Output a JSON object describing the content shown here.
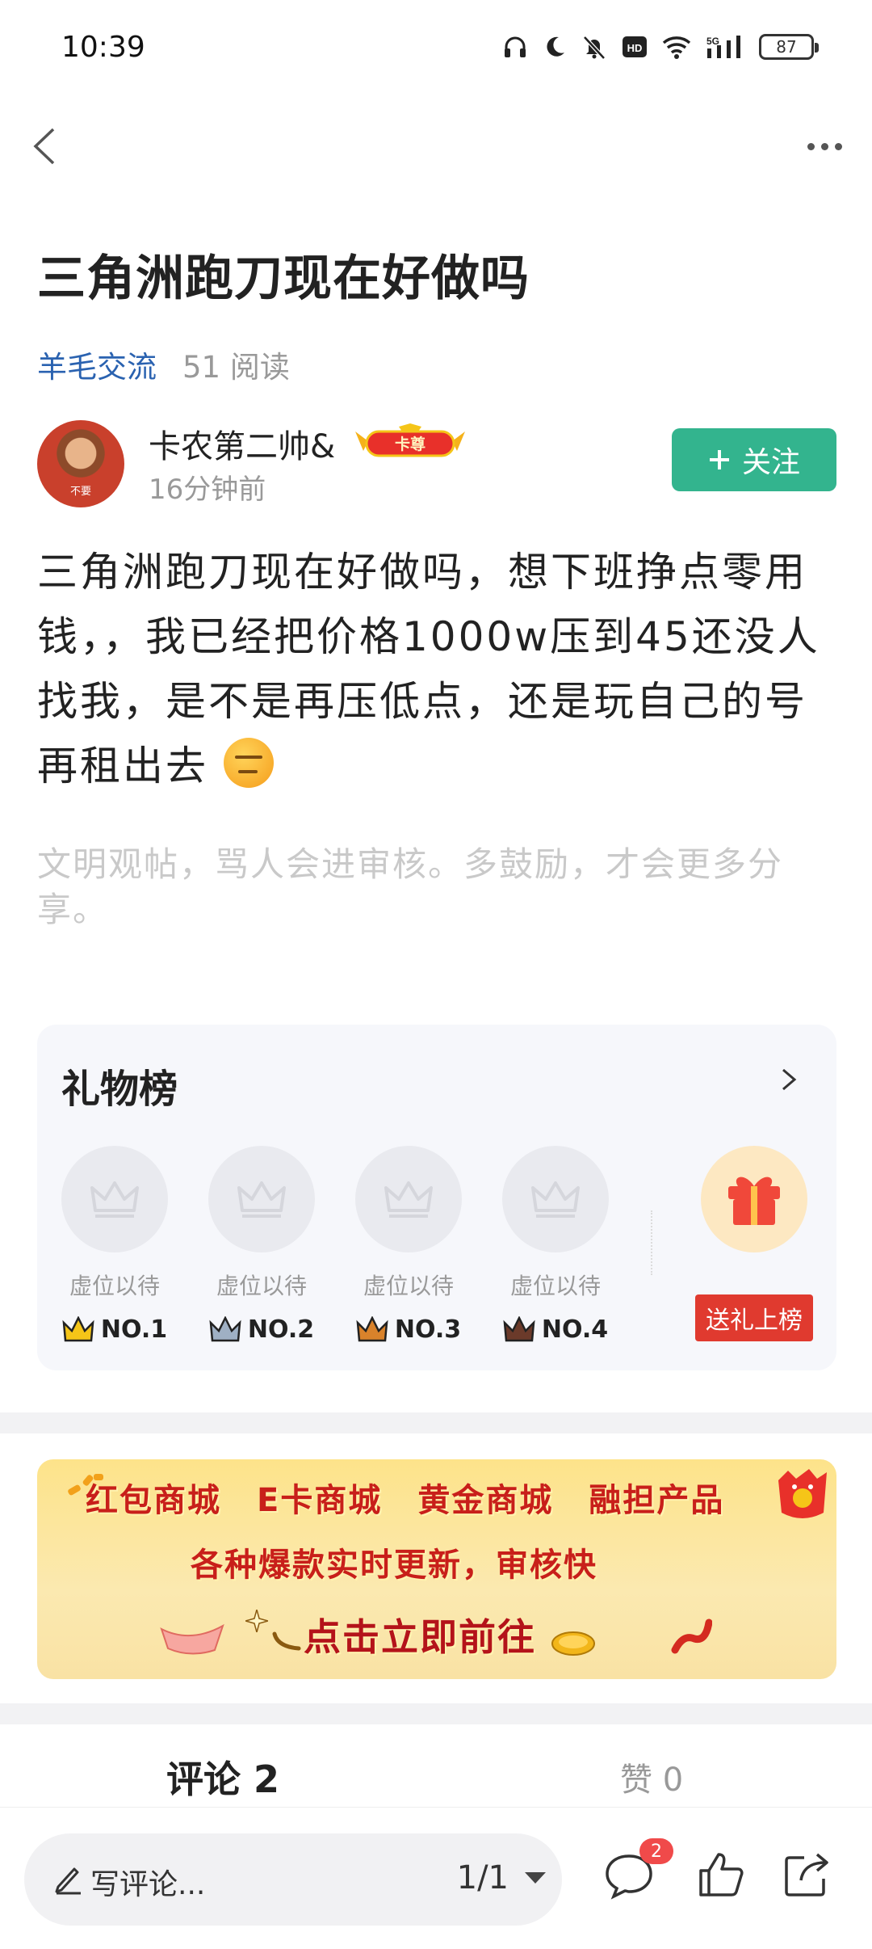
{
  "status_bar": {
    "time": "10:39",
    "battery": "87",
    "icons": [
      "headphones-icon",
      "moon-icon",
      "mute-icon",
      "hd-icon",
      "wifi-icon",
      "5g-signal-icon",
      "battery-icon"
    ]
  },
  "nav": {
    "back_icon": "chevron-left-icon",
    "more_icon": "more-dots-icon"
  },
  "post": {
    "title": "三角洲跑刀现在好做吗",
    "category": "羊毛交流",
    "reads": "51 阅读",
    "author": {
      "name": "卡农第二帅&",
      "badge": "卡尊",
      "time": "16分钟前",
      "avatar_text": "不要"
    },
    "follow_label": "关注",
    "content": "三角洲跑刀现在好做吗，想下班挣点零用钱，，我已经把价格1000w压到45还没人找我，是不是再压低点，还是玩自己的号再租出去",
    "notice": "文明观帖，骂人会进审核。多鼓励，才会更多分享。"
  },
  "gift_board": {
    "title": "礼物榜",
    "slots": [
      {
        "label": "虚位以待",
        "rank": "NO.1",
        "crown_color": "#f5c518"
      },
      {
        "label": "虚位以待",
        "rank": "NO.2",
        "crown_color": "#9fb0c4"
      },
      {
        "label": "虚位以待",
        "rank": "NO.3",
        "crown_color": "#d9822b"
      },
      {
        "label": "虚位以待",
        "rank": "NO.4",
        "crown_color": "#6b3a2a"
      }
    ],
    "send_label": "送礼上榜"
  },
  "banner": {
    "row1": [
      "红包商城",
      "E卡商城",
      "黄金商城",
      "融担产品"
    ],
    "row2": "各种爆款实时更新，审核快",
    "row3": "点击立即前往"
  },
  "tabs": {
    "comments": "评论 2",
    "likes": "赞 0"
  },
  "bottom_bar": {
    "placeholder": "写评论...",
    "pager": "1/1",
    "comment_count": "2"
  },
  "colors": {
    "accent_green": "#33b48e",
    "link_blue": "#2a62b0",
    "red": "#e03a2f"
  }
}
